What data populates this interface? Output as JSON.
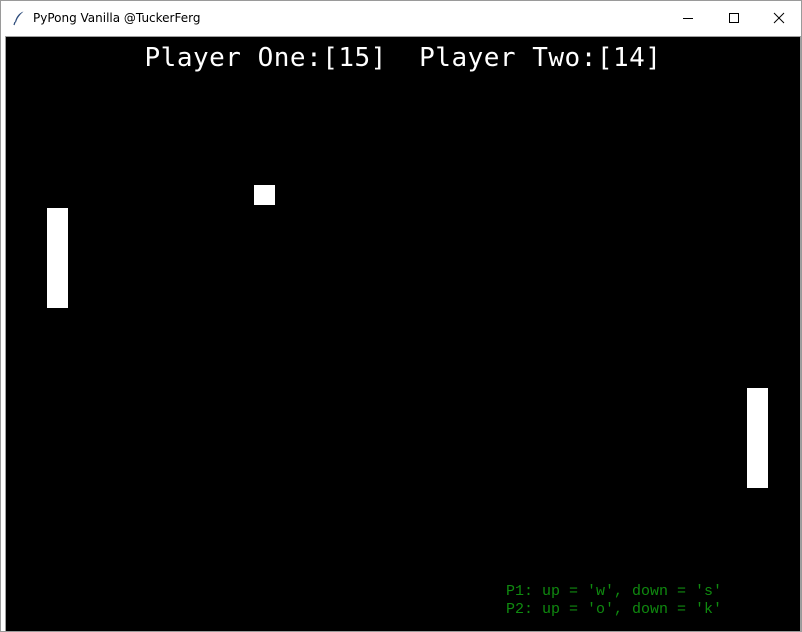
{
  "window": {
    "title": "PyPong Vanilla @TuckerFerg",
    "icon": "feather-icon",
    "buttons": [
      "minimize-icon",
      "maximize-icon",
      "close-icon"
    ]
  },
  "score": {
    "p1_label": "Player One:",
    "p1_value": "[15]",
    "p2_label": "Player Two:",
    "p2_value": "[14]"
  },
  "controls": {
    "p1": "P1: up = 'w', down = 's'",
    "p2": "P2: up = 'o', down = 'k'"
  },
  "colors": {
    "background": "#000000",
    "foreground": "#ffffff",
    "controls_text": "#0f8a0f"
  }
}
